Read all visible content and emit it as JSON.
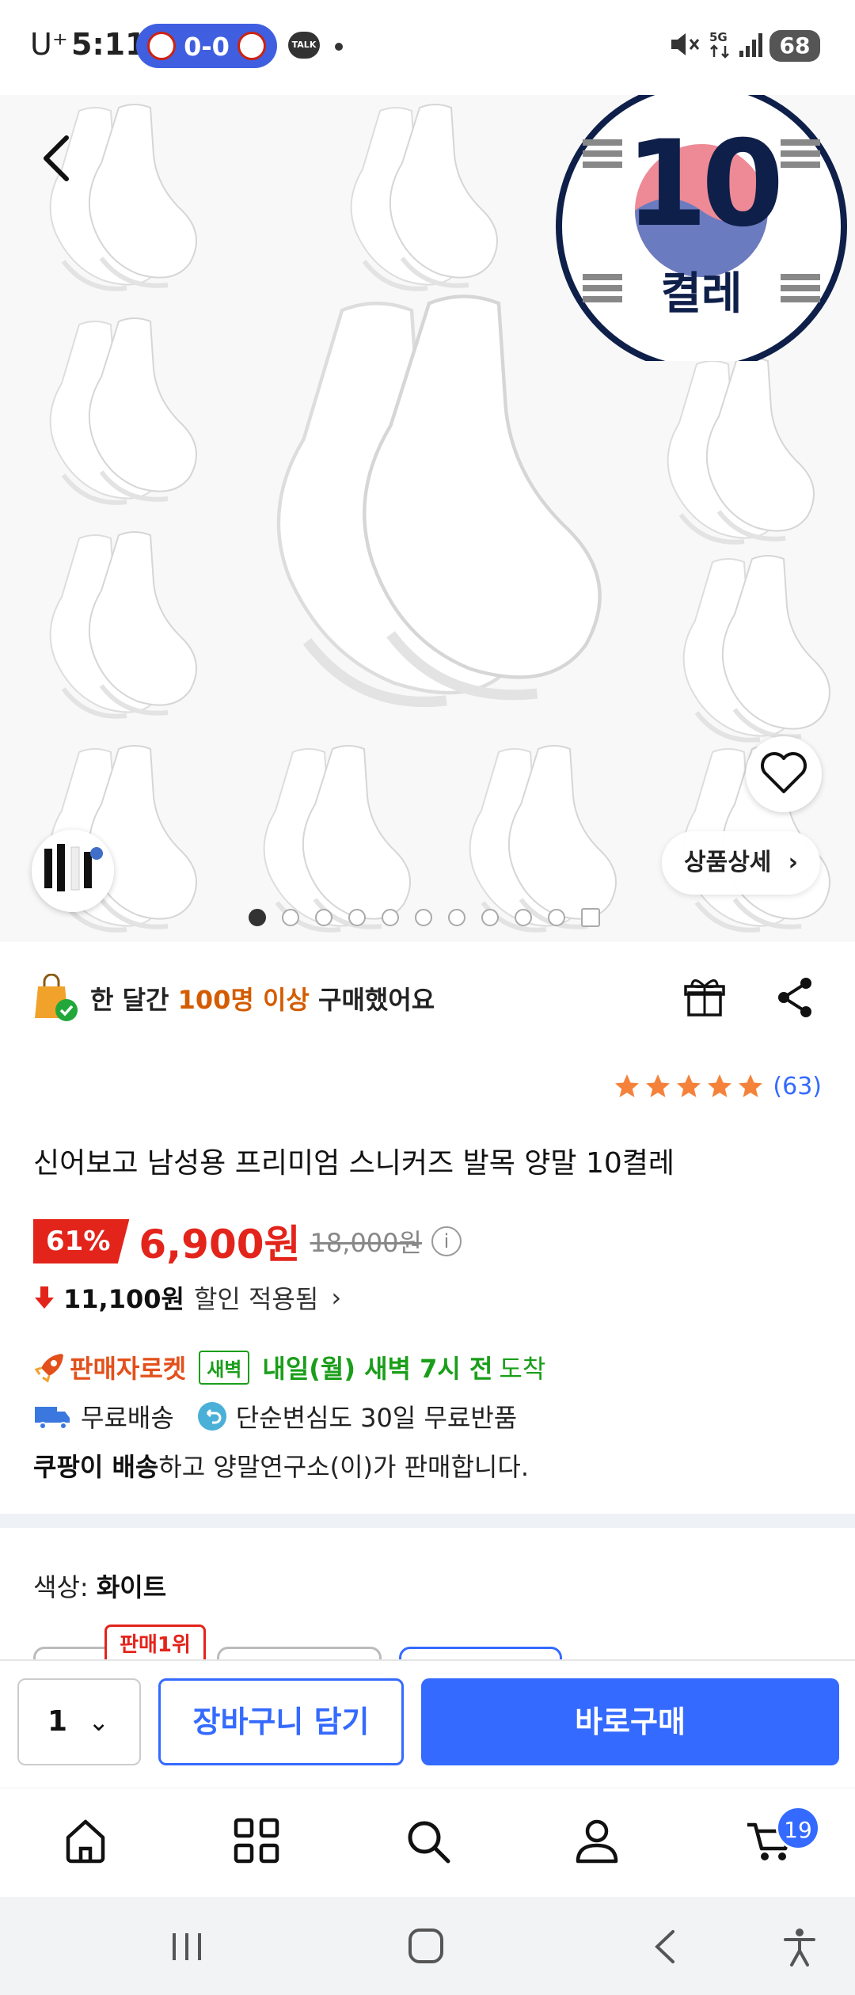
{
  "status_bar": {
    "carrier": "U⁺",
    "time": "5:11",
    "score": "0-0",
    "talk_label": "TALK",
    "battery": "68"
  },
  "hero": {
    "badge_number": "10",
    "badge_text": "켤레",
    "detail_button": "상품상세",
    "slide_count": 10,
    "active_slide": 1
  },
  "purchase_note": {
    "prefix": "한 달간",
    "highlight": "100명 이상",
    "suffix": "구매했어요"
  },
  "rating": {
    "stars": 5,
    "count": "(63)"
  },
  "product": {
    "title": "신어보고 남성용 프리미엄 스니커즈 발목 양말 10켤레",
    "discount": "61%",
    "price": "6,900원",
    "original_price": "18,000원",
    "saving_amount": "11,100원",
    "saving_text": "할인 적용됨"
  },
  "delivery": {
    "rocket_label": "판매자로켓",
    "dawn_badge": "새벽",
    "arrival_bold": "내일(월) 새벽 7시 전",
    "arrival_plain": "도착",
    "free_shipping": "무료배송",
    "free_return": "단순변심도 30일 무료반품",
    "seller_bold": "쿠팡이 배송",
    "seller_rest": "하고 양말연구소(이)가 판매합니다."
  },
  "options": {
    "color_label": "색상:",
    "color_value": "화이트",
    "best_tag": "판매1위"
  },
  "buy_bar": {
    "quantity": "1",
    "cart_button": "장바구니 담기",
    "buy_now_button": "바로구매"
  },
  "bottom_nav": {
    "cart_count": "19"
  },
  "colors": {
    "accent": "#346aff",
    "discount_red": "#e3241b",
    "highlight_orange": "#d45c00",
    "delivery_green": "#1a9e1a"
  }
}
